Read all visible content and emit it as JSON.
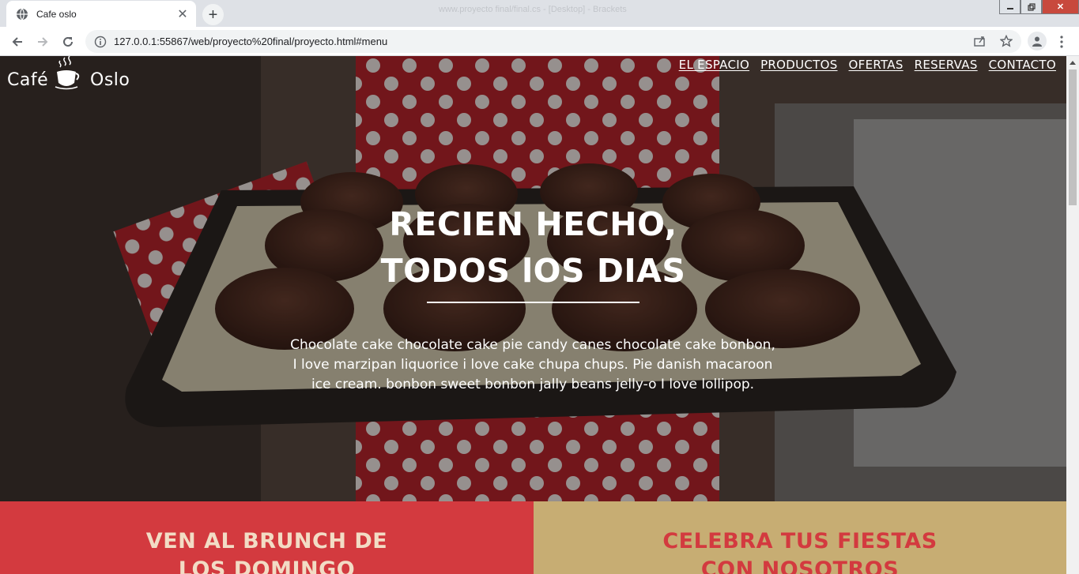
{
  "browser": {
    "tab_title": "Cafe oslo",
    "window_title": "www.proyecto final/final.cs - [Desktop] - Brackets",
    "url": "127.0.0.1:55867/web/proyecto%20final/proyecto.html#menu",
    "icons": [
      "globe-icon",
      "close-icon",
      "plus-icon",
      "back-arrow-icon",
      "forward-arrow-icon",
      "reload-icon",
      "info-icon",
      "share-icon",
      "star-icon",
      "profile-icon",
      "kebab-menu-icon",
      "minimize-icon",
      "restore-icon"
    ]
  },
  "site": {
    "logo_left": "Café",
    "logo_right": "Oslo",
    "nav": [
      "EL ESPACIO",
      "PRODUCTOS",
      "OFERTAS",
      "RESERVAS",
      "CONTACTO"
    ]
  },
  "hero": {
    "headline_line1": "RECIEN HECHO,",
    "headline_line2": "TODOS lOS DIAS",
    "text_line1": "Chocolate cake chocolate cake pie candy canes chocolate cake bonbon,",
    "text_line2": "I love marzipan liquorice i love cake chupa chups. Pie danish macaroon",
    "text_line3": "ice cream. bonbon sweet bonbon jally beans jelly-o I love lollipop."
  },
  "panels": {
    "left_line1": "VEN AL BRUNCH DE",
    "left_line2": "LOS DOMINGO",
    "right_line1": "CELEBRA TUS FIESTAS",
    "right_line2": "CON NOSOTROS"
  },
  "colors": {
    "panel_red": "#d33a3f",
    "panel_tan": "#c7ad73",
    "panel_red_text": "#f2dcc5",
    "panel_tan_text": "#d33a3f"
  }
}
